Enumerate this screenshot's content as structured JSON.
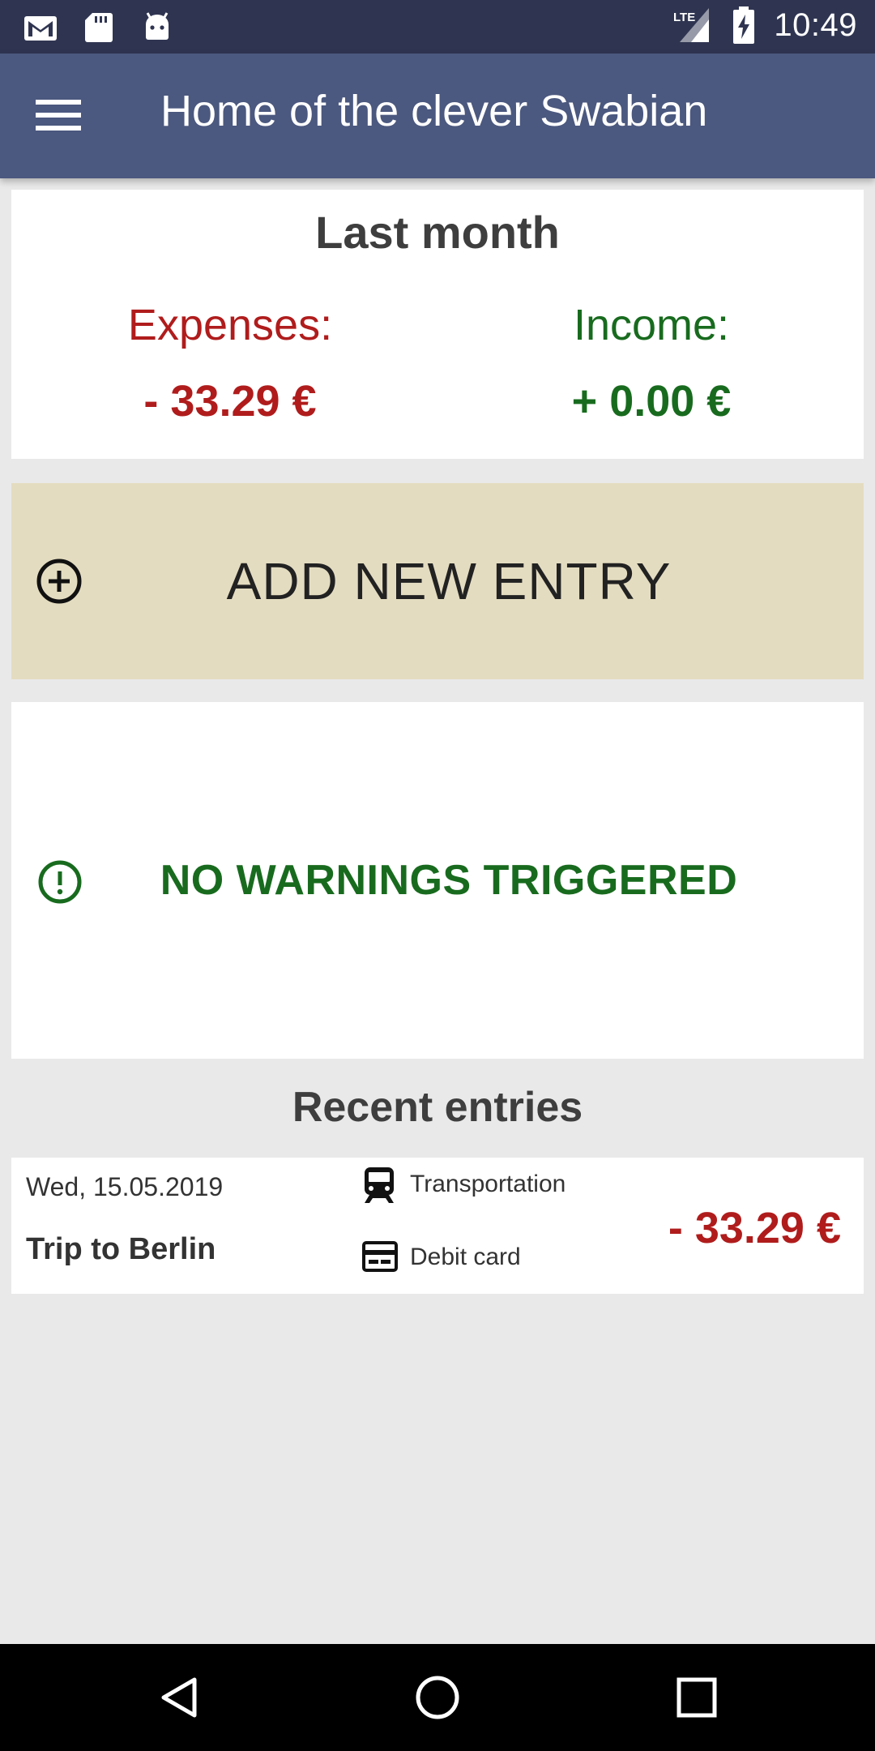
{
  "status_bar": {
    "time": "10:49",
    "network": "LTE",
    "icons": [
      "gmail-icon",
      "sd-card-icon",
      "android-icon",
      "signal-icon",
      "battery-charging-icon"
    ]
  },
  "app_bar": {
    "title": "Home of the clever Swabian",
    "menu_icon": "hamburger-menu-icon"
  },
  "summary": {
    "title": "Last month",
    "expenses_label": "Expenses:",
    "expenses_value": "- 33.29 €",
    "income_label": "Income:",
    "income_value": "+ 0.00 €"
  },
  "actions": {
    "add_entry_label": "ADD NEW ENTRY",
    "add_icon": "add-circle-icon"
  },
  "warnings": {
    "label": "NO WARNINGS TRIGGERED",
    "icon": "alert-circle-icon"
  },
  "recent": {
    "title": "Recent entries",
    "entries": [
      {
        "date": "Wed, 15.05.2019",
        "name": "Trip to Berlin",
        "category": "Transportation",
        "category_icon": "train-icon",
        "payment": "Debit card",
        "payment_icon": "credit-card-icon",
        "amount": "- 33.29 €"
      }
    ]
  },
  "colors": {
    "status_bar": "#2f3551",
    "app_bar": "#4b587f",
    "expense_red": "#b01c1c",
    "income_green": "#186b1e",
    "add_button_bg": "#e4dcc0",
    "background": "#e9e9e9"
  }
}
